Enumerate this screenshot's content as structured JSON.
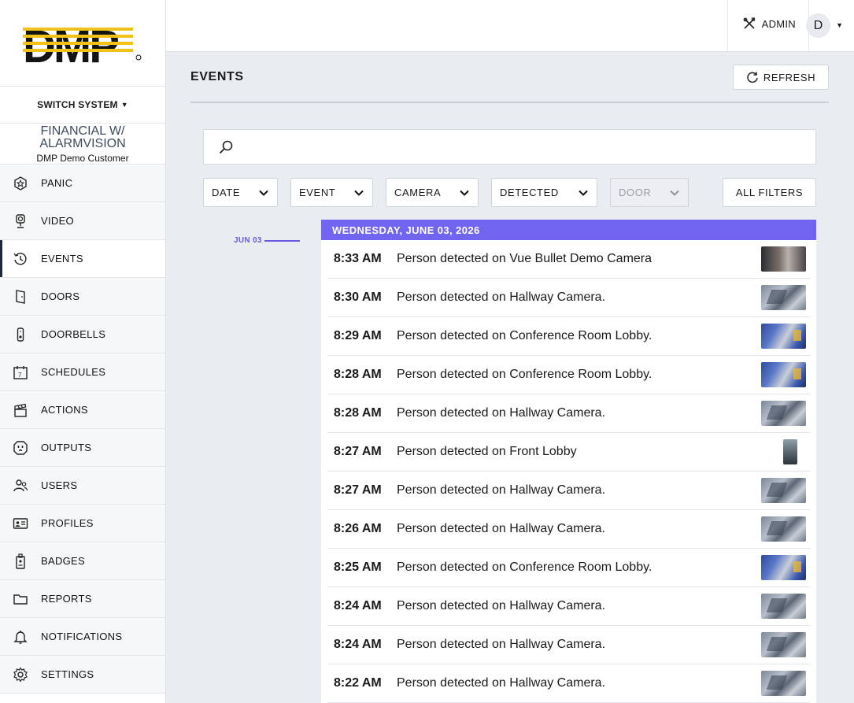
{
  "logo_text": "DMP",
  "sidebar": {
    "switch_label": "SWITCH SYSTEM",
    "system_name": "FINANCIAL W/ ALARMVISION",
    "customer": "DMP Demo Customer",
    "items": [
      {
        "label": "PANIC",
        "icon": "panic-icon"
      },
      {
        "label": "VIDEO",
        "icon": "video-icon"
      },
      {
        "label": "EVENTS",
        "icon": "history-icon",
        "active": true
      },
      {
        "label": "DOORS",
        "icon": "door-icon"
      },
      {
        "label": "DOORBELLS",
        "icon": "doorbell-icon"
      },
      {
        "label": "SCHEDULES",
        "icon": "calendar-icon"
      },
      {
        "label": "ACTIONS",
        "icon": "clapperboard-icon"
      },
      {
        "label": "OUTPUTS",
        "icon": "outlet-icon"
      },
      {
        "label": "USERS",
        "icon": "users-icon"
      },
      {
        "label": "PROFILES",
        "icon": "id-card-icon"
      },
      {
        "label": "BADGES",
        "icon": "badge-icon"
      },
      {
        "label": "REPORTS",
        "icon": "folder-icon"
      },
      {
        "label": "NOTIFICATIONS",
        "icon": "bell-icon"
      },
      {
        "label": "SETTINGS",
        "icon": "gear-icon"
      }
    ]
  },
  "topbar": {
    "admin_label": "ADMIN",
    "avatar_initial": "D"
  },
  "main": {
    "title": "EVENTS",
    "refresh_label": "REFRESH",
    "search_placeholder": "",
    "filters": [
      {
        "label": "DATE",
        "disabled": false
      },
      {
        "label": "EVENT",
        "disabled": false
      },
      {
        "label": "CAMERA",
        "disabled": false
      },
      {
        "label": "DETECTED",
        "disabled": false
      },
      {
        "label": "DOOR",
        "disabled": true
      }
    ],
    "all_filters_label": "ALL FILTERS",
    "timeline_date": "JUN 03",
    "day_header": "WEDNESDAY, JUNE 03, 2026",
    "events": [
      {
        "time": "8:33 AM",
        "desc": "Person detected on Vue Bullet Demo Camera",
        "thumb": "vue"
      },
      {
        "time": "8:30 AM",
        "desc": "Person detected on Hallway Camera.",
        "thumb": "hall"
      },
      {
        "time": "8:29 AM",
        "desc": "Person detected on Conference Room Lobby.",
        "thumb": "conf"
      },
      {
        "time": "8:28 AM",
        "desc": "Person detected on Conference Room Lobby.",
        "thumb": "conf"
      },
      {
        "time": "8:28 AM",
        "desc": "Person detected on Hallway Camera.",
        "thumb": "hall"
      },
      {
        "time": "8:27 AM",
        "desc": "Person detected on Front Lobby",
        "thumb": "front"
      },
      {
        "time": "8:27 AM",
        "desc": "Person detected on Hallway Camera.",
        "thumb": "hall"
      },
      {
        "time": "8:26 AM",
        "desc": "Person detected on Hallway Camera.",
        "thumb": "hall"
      },
      {
        "time": "8:25 AM",
        "desc": "Person detected on Conference Room Lobby.",
        "thumb": "conf"
      },
      {
        "time": "8:24 AM",
        "desc": "Person detected on Hallway Camera.",
        "thumb": "hall"
      },
      {
        "time": "8:24 AM",
        "desc": "Person detected on Hallway Camera.",
        "thumb": "hall"
      },
      {
        "time": "8:22 AM",
        "desc": "Person detected on Hallway Camera.",
        "thumb": "hall"
      }
    ]
  },
  "colors": {
    "accent": "#7064f0",
    "logo_yellow": "#f3c21a"
  }
}
